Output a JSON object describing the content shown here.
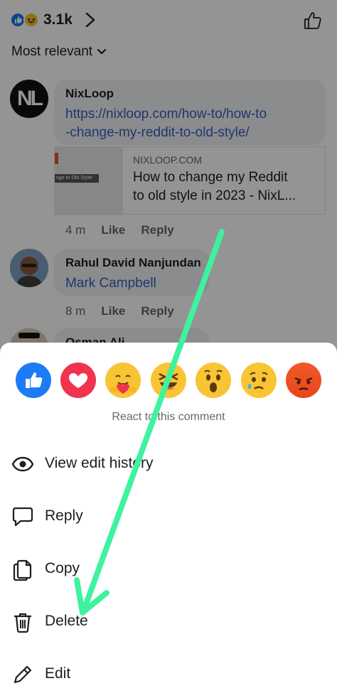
{
  "header": {
    "reaction_count": "3.1k",
    "sort_label": "Most relevant"
  },
  "comments": [
    {
      "author": "NixLoop",
      "avatar_text": "NL",
      "text": "https://nixloop.com/how-to/how-to-change-my-reddit-to-old-style/",
      "text_line1": "https://nixloop.com/how-to/how-to",
      "text_line2": "-change-my-reddit-to-old-style/",
      "link_preview": {
        "thumb_caption": "nge to Old Style!",
        "domain": "NIXLOOP.COM",
        "title_line1": "How to change my Reddit",
        "title_line2": "to old style in 2023 - NixL..."
      },
      "time": "4 m",
      "like_label": "Like",
      "reply_label": "Reply"
    },
    {
      "author": "Rahul David Nanjundan",
      "text": "Mark Campbell",
      "time": "8 m",
      "like_label": "Like",
      "reply_label": "Reply"
    },
    {
      "author": "Osman Ali"
    }
  ],
  "sheet": {
    "reactions": [
      "like",
      "love",
      "care",
      "haha",
      "wow",
      "sad",
      "angry"
    ],
    "caption": "React to this comment",
    "menu": [
      {
        "label": "View edit history",
        "icon": "eye-icon"
      },
      {
        "label": "Reply",
        "icon": "speech-bubble-icon"
      },
      {
        "label": "Copy",
        "icon": "copy-icon"
      },
      {
        "label": "Delete",
        "icon": "trash-icon"
      },
      {
        "label": "Edit",
        "icon": "pencil-icon"
      }
    ]
  },
  "colors": {
    "link": "#3a5eb8",
    "annotation_arrow": "#3ef2a0",
    "like_blue": "#1b7cf5",
    "love_red": "#f0334f"
  }
}
